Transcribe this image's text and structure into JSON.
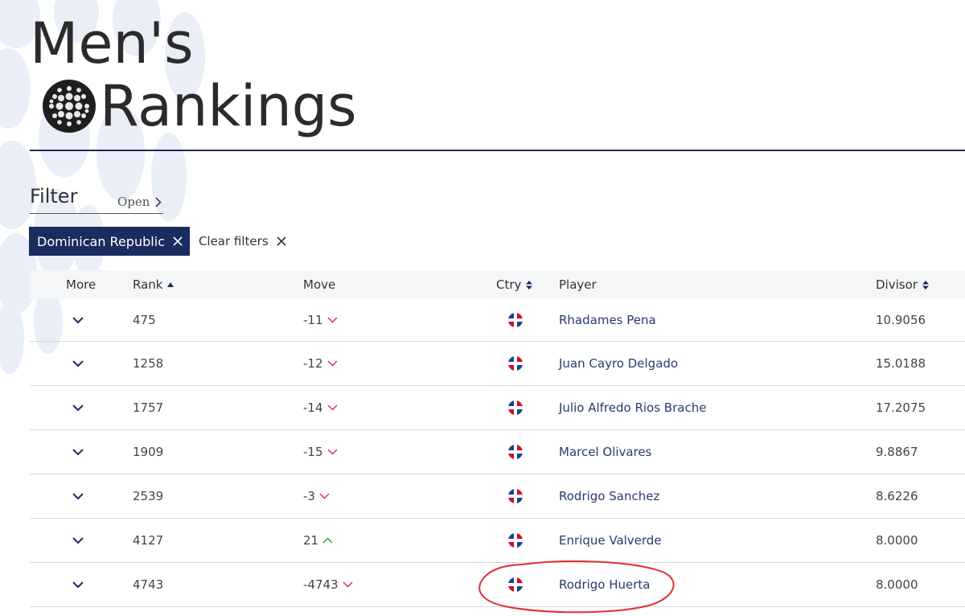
{
  "header": {
    "title_line1": "Men's",
    "title_line2": "Rankings"
  },
  "filter": {
    "label": "Filter",
    "open_label": "Open"
  },
  "chips": {
    "active_filter": "Dominican Republic",
    "clear_label": "Clear filters"
  },
  "table": {
    "columns": {
      "more": "More",
      "rank": "Rank",
      "move": "Move",
      "ctry": "Ctry",
      "player": "Player",
      "divisor": "Divisor"
    },
    "rows": [
      {
        "rank": "475",
        "move": "-11",
        "direction": "down",
        "player": "Rhadames Pena",
        "divisor": "10.9056"
      },
      {
        "rank": "1258",
        "move": "-12",
        "direction": "down",
        "player": "Juan Cayro Delgado",
        "divisor": "15.0188"
      },
      {
        "rank": "1757",
        "move": "-14",
        "direction": "down",
        "player": "Julio Alfredo Rios Brache",
        "divisor": "17.2075"
      },
      {
        "rank": "1909",
        "move": "-15",
        "direction": "down",
        "player": "Marcel Olivares",
        "divisor": "9.8867"
      },
      {
        "rank": "2539",
        "move": "-3",
        "direction": "down",
        "player": "Rodrigo Sanchez",
        "divisor": "8.6226"
      },
      {
        "rank": "4127",
        "move": "21",
        "direction": "up",
        "player": "Enrique Valverde",
        "divisor": "8.0000"
      },
      {
        "rank": "4743",
        "move": "-4743",
        "direction": "down",
        "player": "Rodrigo Huerta",
        "divisor": "8.0000"
      }
    ]
  },
  "colors": {
    "navy": "#1a2b5e",
    "down": "#d9333f",
    "up": "#2e9b4a",
    "link": "#2a3a6e"
  }
}
